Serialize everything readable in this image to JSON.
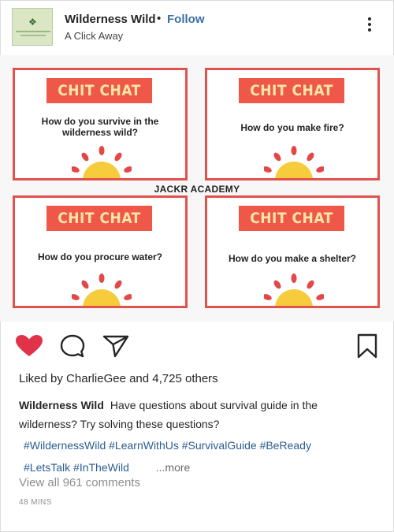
{
  "header": {
    "username": "Wilderness Wild",
    "separator": "•",
    "follow_label": "Follow",
    "subtitle": "A Click Away",
    "avatar_icon": "leaf-logo-icon",
    "options_icon": "more-options-icon"
  },
  "post": {
    "cards": [
      {
        "tag": "CHIT CHAT",
        "question": "How do you survive in the wilderness wild?"
      },
      {
        "tag": "CHIT CHAT",
        "question": "How do you make fire?"
      },
      {
        "tag": "CHIT CHAT",
        "question": "How do you procure water?"
      },
      {
        "tag": "CHIT CHAT",
        "question": "How do you make a shelter?"
      }
    ],
    "center_label": "JACKR ACADEMY",
    "colors": {
      "border": "#e2524c",
      "tag_bg": "#ef5749",
      "tag_text": "#fde7a6",
      "sun": "#f6cc3d",
      "rays": "#e34848"
    }
  },
  "actions": {
    "like_icon": "heart-icon",
    "comment_icon": "comment-icon",
    "share_icon": "send-icon",
    "save_icon": "bookmark-icon",
    "liked_color": "#e0334a"
  },
  "likes": {
    "prefix": "Liked by",
    "user": "CharlieGee",
    "suffix": "and 4,725 others"
  },
  "caption": {
    "owner": "Wilderness Wild",
    "text_line1": "Have questions about survival guide in the",
    "text_line2": "wilderness? Try solving these questions?",
    "hashtags_row1": [
      "#WildernessWild",
      "#LearnWithUs",
      "#SurvivalGuide",
      "#BeReady"
    ],
    "hashtags_row2": [
      "#LetsTalk",
      "#InTheWild"
    ],
    "more_label": "...more"
  },
  "comments": {
    "view_all": "View all 961 comments"
  },
  "timestamp": "48 MINS"
}
